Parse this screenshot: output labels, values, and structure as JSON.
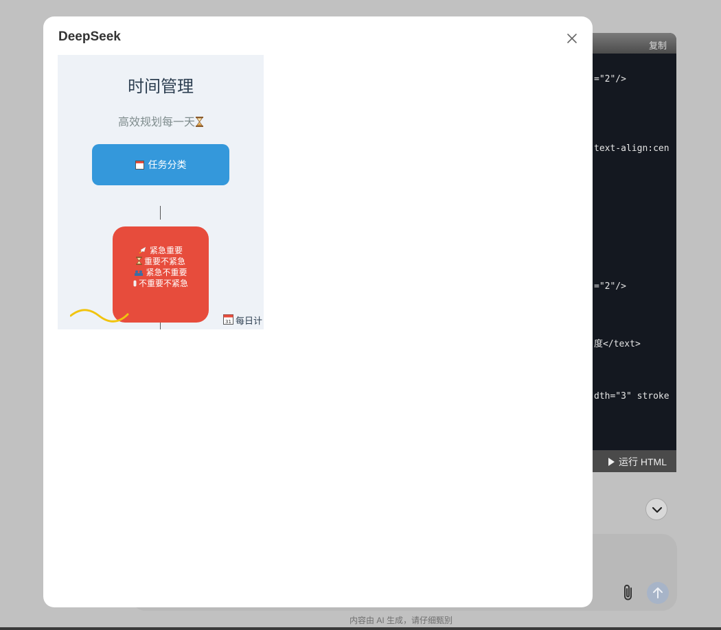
{
  "code_panel": {
    "copy_label": "复制",
    "lines": [
      "=\"2\"/>",
      "text-align:cen",
      "=\"2\"/>",
      "度</text>",
      "dth=\"3\" stroke"
    ],
    "run_label": "运行 HTML"
  },
  "footer_note": "内容由 AI 生成，请仔细甄别",
  "modal": {
    "title": "DeepSeek",
    "preview": {
      "title": "时间管理",
      "subtitle": "高效规划每一天",
      "task_node": "任务分类",
      "quadrants": [
        "紧急重要",
        "重要不紧急",
        "紧急不重要",
        "不重要不紧急"
      ],
      "daily_label": "每日计"
    }
  },
  "colors": {
    "overlay": "#c1c1c1",
    "code_bg": "#141820",
    "task_node": "#3498db",
    "quad_node": "#e74c3c",
    "wave": "#f1c40f",
    "preview_bg": "#eef2f7"
  },
  "icons": [
    "close-icon",
    "chevron-down-icon",
    "paperclip-icon",
    "arrow-up-icon",
    "hourglass-icon",
    "calendar-icon",
    "rocket-icon",
    "play-icon"
  ]
}
